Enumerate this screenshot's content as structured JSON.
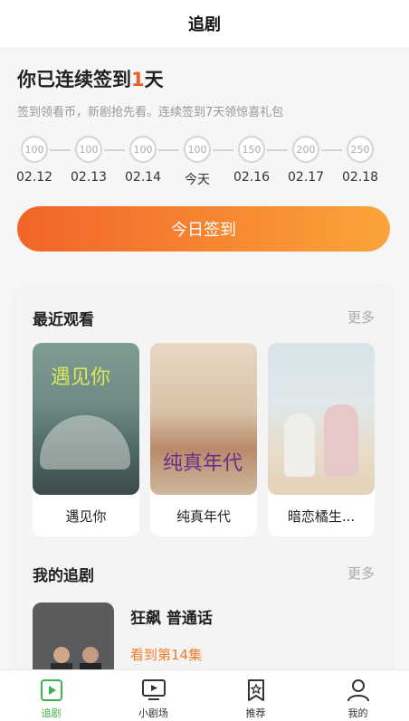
{
  "header": {
    "title": "追剧"
  },
  "checkin": {
    "title_prefix": "你已连续签到",
    "title_days": "1",
    "title_suffix": "天",
    "subtitle": "签到领看币，新剧抢先看。连续签到7天领惊喜礼包",
    "days": [
      {
        "coins": "100",
        "date": "02.12"
      },
      {
        "coins": "100",
        "date": "02.13"
      },
      {
        "coins": "100",
        "date": "02.14"
      },
      {
        "coins": "100",
        "date": "今天"
      },
      {
        "coins": "150",
        "date": "02.16"
      },
      {
        "coins": "200",
        "date": "02.17"
      },
      {
        "coins": "250",
        "date": "02.18"
      }
    ],
    "button_label": "今日签到"
  },
  "recent": {
    "title": "最近观看",
    "more": "更多",
    "items": [
      {
        "name": "遇见你",
        "poster_text": "遇见你"
      },
      {
        "name": "纯真年代",
        "poster_text": "纯真年代"
      },
      {
        "name": "暗恋橘生..."
      }
    ]
  },
  "my_shows": {
    "title": "我的追剧",
    "more": "更多",
    "items": [
      {
        "name": "狂飙 普通话",
        "progress": "看到第14集"
      }
    ]
  },
  "tabbar": {
    "items": [
      {
        "label": "追剧",
        "icon": "play-square-icon",
        "active": true
      },
      {
        "label": "小剧场",
        "icon": "tv-icon",
        "active": false
      },
      {
        "label": "推荐",
        "icon": "bookmark-star-icon",
        "active": false
      },
      {
        "label": "我的",
        "icon": "user-icon",
        "active": false
      }
    ]
  },
  "colors": {
    "accent": "#f15a22",
    "button_gradient_start": "#f26428",
    "button_gradient_end": "#fba43a",
    "active_tab": "#3bb24a",
    "progress_text": "#f07d2c"
  }
}
